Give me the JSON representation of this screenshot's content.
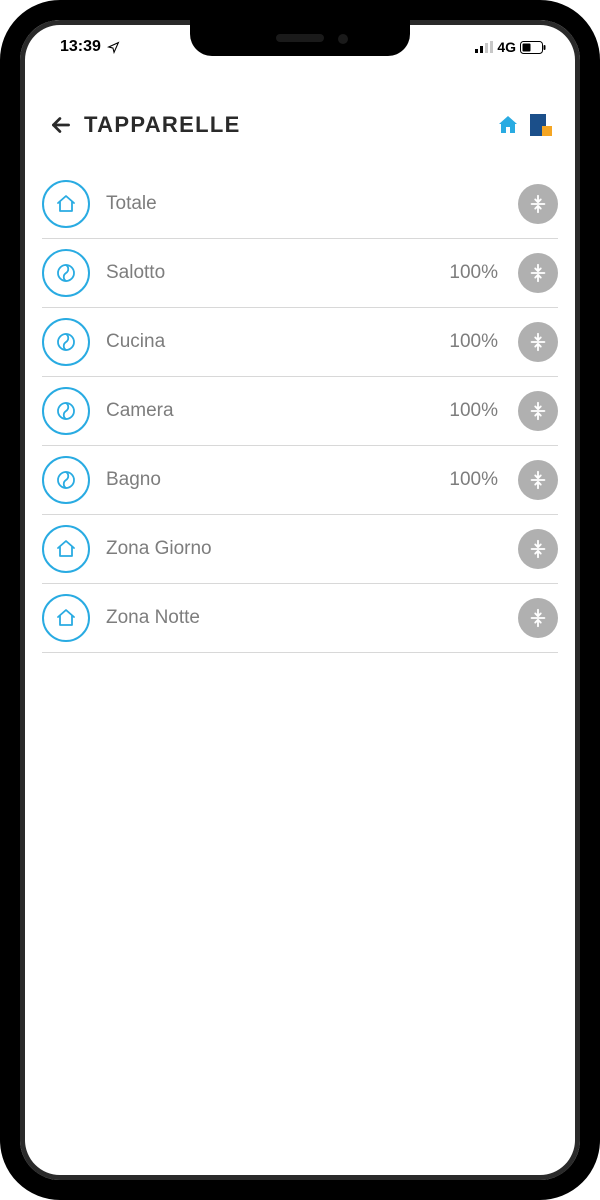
{
  "status": {
    "time": "13:39",
    "network": "4G"
  },
  "header": {
    "title": "TAPPARELLE"
  },
  "rows": [
    {
      "label": "Totale",
      "value": "",
      "icon": "home"
    },
    {
      "label": "Salotto",
      "value": "100%",
      "icon": "shutter"
    },
    {
      "label": "Cucina",
      "value": "100%",
      "icon": "shutter"
    },
    {
      "label": "Camera",
      "value": "100%",
      "icon": "shutter"
    },
    {
      "label": "Bagno",
      "value": "100%",
      "icon": "shutter"
    },
    {
      "label": "Zona Giorno",
      "value": "",
      "icon": "home"
    },
    {
      "label": "Zona Notte",
      "value": "",
      "icon": "home"
    }
  ],
  "colors": {
    "accent": "#29abe2",
    "grey": "#b0b0b0",
    "text": "#7d7d7d"
  }
}
